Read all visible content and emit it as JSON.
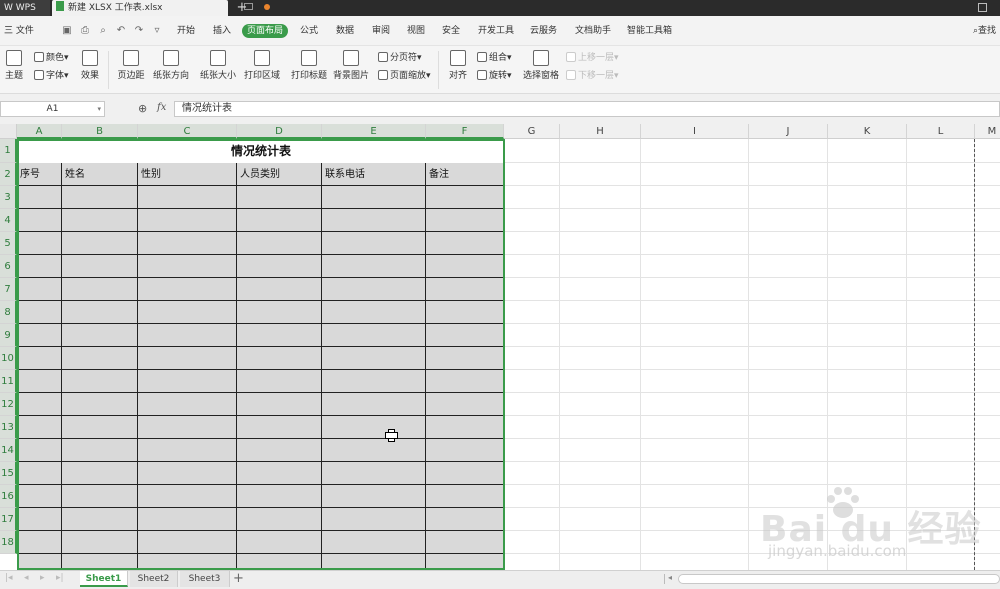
{
  "titlebar": {
    "app_tab": "WPS",
    "file_tab": "新建 XLSX 工作表.xlsx",
    "new_tab": "+"
  },
  "menubar": {
    "file_menu": "三 文件",
    "items": [
      "开始",
      "插入",
      "页面布局",
      "公式",
      "数据",
      "审阅",
      "视图",
      "安全",
      "开发工具",
      "云服务",
      "文档助手",
      "智能工具箱"
    ],
    "active_item": "页面布局",
    "search": "查找"
  },
  "ribbon": {
    "theme": "主题",
    "colors": "颜色",
    "fonts": "字体",
    "effects": "效果",
    "margins": "页边距",
    "orientation": "纸张方向",
    "size": "纸张大小",
    "print_area": "打印区域",
    "print_titles": "打印标题",
    "background": "背景图片",
    "page_break": "分页符",
    "page_zoom": "页面缩放",
    "align": "对齐",
    "group": "组合",
    "rotate": "旋转",
    "selection_pane": "选择窗格",
    "bring_forward": "上移一层",
    "send_backward": "下移一层"
  },
  "formula_bar": {
    "name_box": "A1",
    "fx": "fx",
    "content": "情况统计表"
  },
  "grid": {
    "columns": [
      "A",
      "B",
      "C",
      "D",
      "E",
      "F",
      "G",
      "H",
      "I",
      "J",
      "K",
      "L",
      "M"
    ],
    "rows": [
      "1",
      "2",
      "3",
      "4",
      "5",
      "6",
      "7",
      "8",
      "9",
      "10",
      "11",
      "12",
      "13",
      "14",
      "15",
      "16",
      "17",
      "18"
    ],
    "title_cell": "情况统计表",
    "headers": [
      "序号",
      "姓名",
      "性别",
      "人员类别",
      "联系电话",
      "备注"
    ]
  },
  "sheets": {
    "tabs": [
      "Sheet1",
      "Sheet2",
      "Sheet3"
    ],
    "active": "Sheet1",
    "add": "+"
  },
  "watermark": {
    "text": "Bai du 经验",
    "sub": "jingyan.baidu.com"
  },
  "colors": {
    "accent": "#3a9b4a",
    "table_fill": "#d9d9d9"
  }
}
